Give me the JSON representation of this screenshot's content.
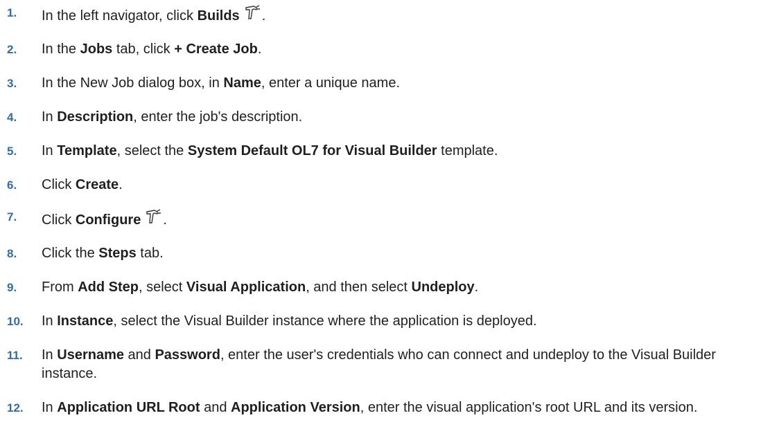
{
  "steps": [
    {
      "number": "1.",
      "parts": [
        "In the left navigator, click ",
        "Builds",
        "",
        ".",
        ""
      ],
      "icon": "builds-hammer-icon"
    },
    {
      "number": "2.",
      "parts": [
        "In the ",
        "Jobs",
        " tab, click ",
        "+ Create Job",
        "."
      ]
    },
    {
      "number": "3.",
      "parts": [
        "In the New Job dialog box, in ",
        "Name",
        ", enter a unique name."
      ]
    },
    {
      "number": "4.",
      "parts": [
        "In ",
        "Description",
        ", enter the job's description."
      ]
    },
    {
      "number": "5.",
      "parts": [
        "In ",
        "Template",
        ", select the ",
        "System Default OL7 for Visual Builder",
        " template."
      ]
    },
    {
      "number": "6.",
      "parts": [
        "Click ",
        "Create",
        "."
      ]
    },
    {
      "number": "7.",
      "parts": [
        "Click ",
        "Configure",
        "",
        ".",
        ""
      ],
      "icon": "configure-hammer-icon"
    },
    {
      "number": "8.",
      "parts": [
        "Click the ",
        "Steps",
        " tab."
      ]
    },
    {
      "number": "9.",
      "parts": [
        "From ",
        "Add Step",
        ", select ",
        "Visual Application",
        ", and then select ",
        "Undeploy",
        "."
      ]
    },
    {
      "number": "10.",
      "parts": [
        "In ",
        "Instance",
        ", select the Visual Builder instance where the application is deployed."
      ]
    },
    {
      "number": "11.",
      "parts": [
        "In ",
        "Username",
        " and ",
        "Password",
        ", enter the user's credentials who can connect and undeploy to the Visual Builder instance."
      ]
    },
    {
      "number": "12.",
      "parts": [
        "In ",
        "Application URL Root",
        " and ",
        "Application Version",
        ", enter the visual application's root URL and its version."
      ]
    }
  ]
}
